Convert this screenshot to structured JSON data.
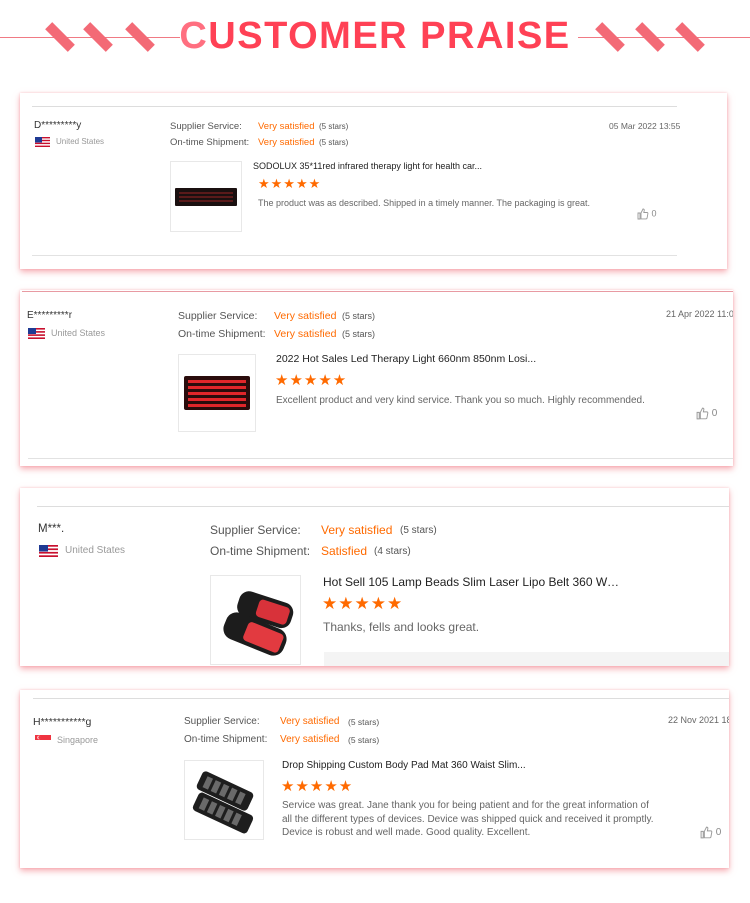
{
  "header": {
    "title_first_letter": "C",
    "title_rest": "USTOMER PRAISE"
  },
  "labels": {
    "supplier": "Supplier Service:",
    "shipment": "On-time Shipment:"
  },
  "reviews": [
    {
      "user": "D*********y",
      "country": "United States",
      "flag": "us",
      "supplier_rating": "Very satisfied",
      "supplier_stars": "(5 stars)",
      "shipment_rating": "Very satisfied",
      "shipment_stars": "(5 stars)",
      "date": "05 Mar 2022 13:55",
      "product": "SODOLUX 35*11red infrared therapy light for health car...",
      "stars": "★★★★★",
      "text": "The product was as described.  Shipped in a timely manner.  The packaging is great.",
      "likes": "0"
    },
    {
      "user": "E*********r",
      "country": "United States",
      "flag": "us",
      "supplier_rating": "Very satisfied",
      "supplier_stars": "(5 stars)",
      "shipment_rating": "Very satisfied",
      "shipment_stars": "(5 stars)",
      "date": "21 Apr 2022 11:0",
      "product": "2022 Hot Sales Led Therapy Light 660nm 850nm Losi...",
      "stars": "★★★★★",
      "text": "Excellent product and very kind service. Thank you so much. Highly recommended.",
      "likes": "0"
    },
    {
      "user": "M***.",
      "country": "United States",
      "flag": "us",
      "supplier_rating": "Very satisfied",
      "supplier_stars": "(5 stars)",
      "shipment_rating": "Satisfied",
      "shipment_stars": "(4 stars)",
      "date": "",
      "product": "Hot Sell 105 Lamp Beads Slim Laser Lipo Belt 360 We...",
      "stars": "★★★★★",
      "text": "Thanks, fells and looks great.",
      "likes": ""
    },
    {
      "user": "H***********g",
      "country": "Singapore",
      "flag": "sg",
      "supplier_rating": "Very satisfied",
      "supplier_stars": "(5 stars)",
      "shipment_rating": "Very satisfied",
      "shipment_stars": "(5 stars)",
      "date": "22 Nov 2021 18",
      "product": "Drop Shipping Custom Body Pad Mat 360 Waist Slim...",
      "stars": "★★★★★",
      "text": "Service was great. Jane thank you for being patient and for the great information of all the different types of devices. Device was shipped quick and received it promptly. Device is robust and well made. Good quality. Excellent.",
      "likes": "0"
    }
  ]
}
